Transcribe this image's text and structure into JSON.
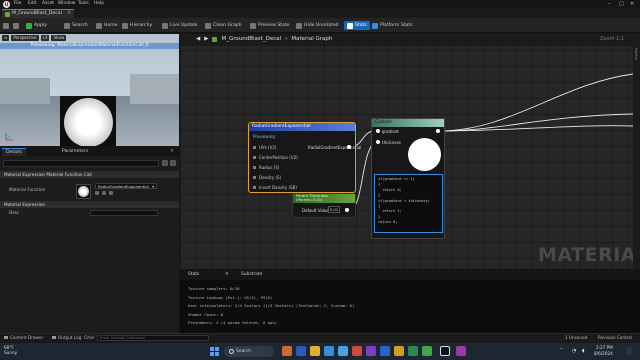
{
  "menu": {
    "items": [
      "File",
      "Edit",
      "Asset",
      "Window",
      "Tools",
      "Help"
    ]
  },
  "doc_tab": {
    "title": "M_GroundBlast_Decal"
  },
  "toolbar": {
    "apply": "Apply",
    "search": "Search",
    "home": "Home",
    "hierarchy": "Hierarchy",
    "live_update": "Live Update",
    "clean_graph": "Clean Graph",
    "preview_state": "Preview State",
    "hide_unrelated": "Hide Unrelated",
    "stats": "Stats",
    "platform_stats": "Platform Stats"
  },
  "viewport": {
    "buttons": [
      "Perspective",
      "Lit",
      "Show"
    ],
    "preview_label": "Previewing: MaterialExpressionMaterialFunctionCall_0"
  },
  "details": {
    "tabs": [
      "Details",
      "Parameters"
    ],
    "section_function_call": "Material Expression Material Function Call",
    "material_function_label": "Material Function",
    "material_function_value": "RadialGradientExponential",
    "section_expression": "Material Expression",
    "desc_label": "Desc"
  },
  "graph": {
    "breadcrumb_asset": "M_GroundBlast_Decal",
    "breadcrumb_graph": "Material Graph",
    "zoom": "Zoom 1:1",
    "watermark": "MATERIAL",
    "right_strip": "Palette"
  },
  "radial_node": {
    "title": "RadialGradientExponential",
    "subtitle": "Previewing",
    "inputs": [
      "UVs (V2)",
      "CenterPosition (V2)",
      "Radius (S)",
      "Density (S)",
      "Invert Density (SB)"
    ],
    "output": "RadialGradientExponential"
  },
  "param_node": {
    "title": "Param Thickness",
    "subtitle": "(Param=0.01)",
    "label": "Default Value",
    "value": "0.01"
  },
  "custom_node": {
    "title": "Custom",
    "inputs": [
      "gradient",
      "thickness"
    ],
    "code": "if(gradient >= 1)\n{\n  return 0;\n}\nif(gradient < thickness)\n{\n  return 1;\n}\nreturn 0;"
  },
  "stats_panel": {
    "tabs": [
      "Stats",
      "Substrate"
    ],
    "lines": [
      "Texture samplers: 0/16",
      "Texture Lookups (Est.): VS(3), PS(0)",
      "User interpolators: 2/4 Scalars (1/4 Vectors) (TexCoords: 2, Custom: 0)",
      "Shader Count: 0",
      "Preshaders: 4 (4 param fetches, 0 ops)"
    ]
  },
  "statusbar": {
    "content_drawer": "Content Drawer",
    "output_log": "Output Log",
    "cmd": "Cmd",
    "cmd_placeholder": "Enter Console Command",
    "unsaved": "1 Unsaved",
    "revision_control": "Revision Control"
  },
  "taskbar": {
    "weather_temp": "68°F",
    "weather_cond": "Sunny",
    "search": "Search",
    "time": "2:27 PM",
    "date": "8/6/2024"
  },
  "colors": {
    "accent": "#3a8cdc",
    "node_selected": "#e0a030",
    "stats_button": "#1565c0"
  }
}
